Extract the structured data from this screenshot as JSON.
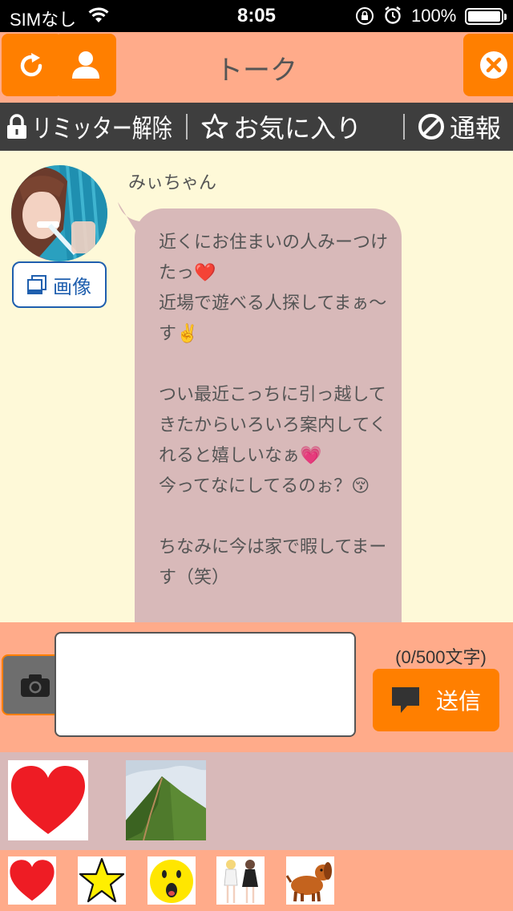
{
  "status_bar": {
    "carrier": "SIMなし",
    "time": "8:05",
    "battery_percent": "100%"
  },
  "nav": {
    "title": "トーク"
  },
  "actions": {
    "limiter_label": "リミッター解除",
    "favorite_label": "お気に入り",
    "report_label": "通報"
  },
  "chat": {
    "sender_name": "みぃちゃん",
    "image_button_label": "画像",
    "message": "近くにお住まいの人みーつけたっ❤️\n近場で遊べる人探してまぁ〜す✌️\n\nつい最近こっちに引っ越してきたからいろいろ案内してくれると嬉しいなぁ💗\n今ってなにしてるのぉ？😚\n\nちなみに今は家で暇してまーす（笑）"
  },
  "composer": {
    "text_value": "",
    "char_count": "(0/500文字)",
    "send_label": "送信"
  },
  "colors": {
    "accent_orange": "#ff7f00",
    "salmon": "#ffab8a",
    "bubble": "#d8b9b9",
    "chat_bg": "#fef9d8",
    "action_bar": "#3e3e3e"
  },
  "stamps": {
    "large": [
      "heart",
      "mountain"
    ],
    "small": [
      "heart",
      "star",
      "surprised-face",
      "two-girls",
      "dog"
    ]
  }
}
